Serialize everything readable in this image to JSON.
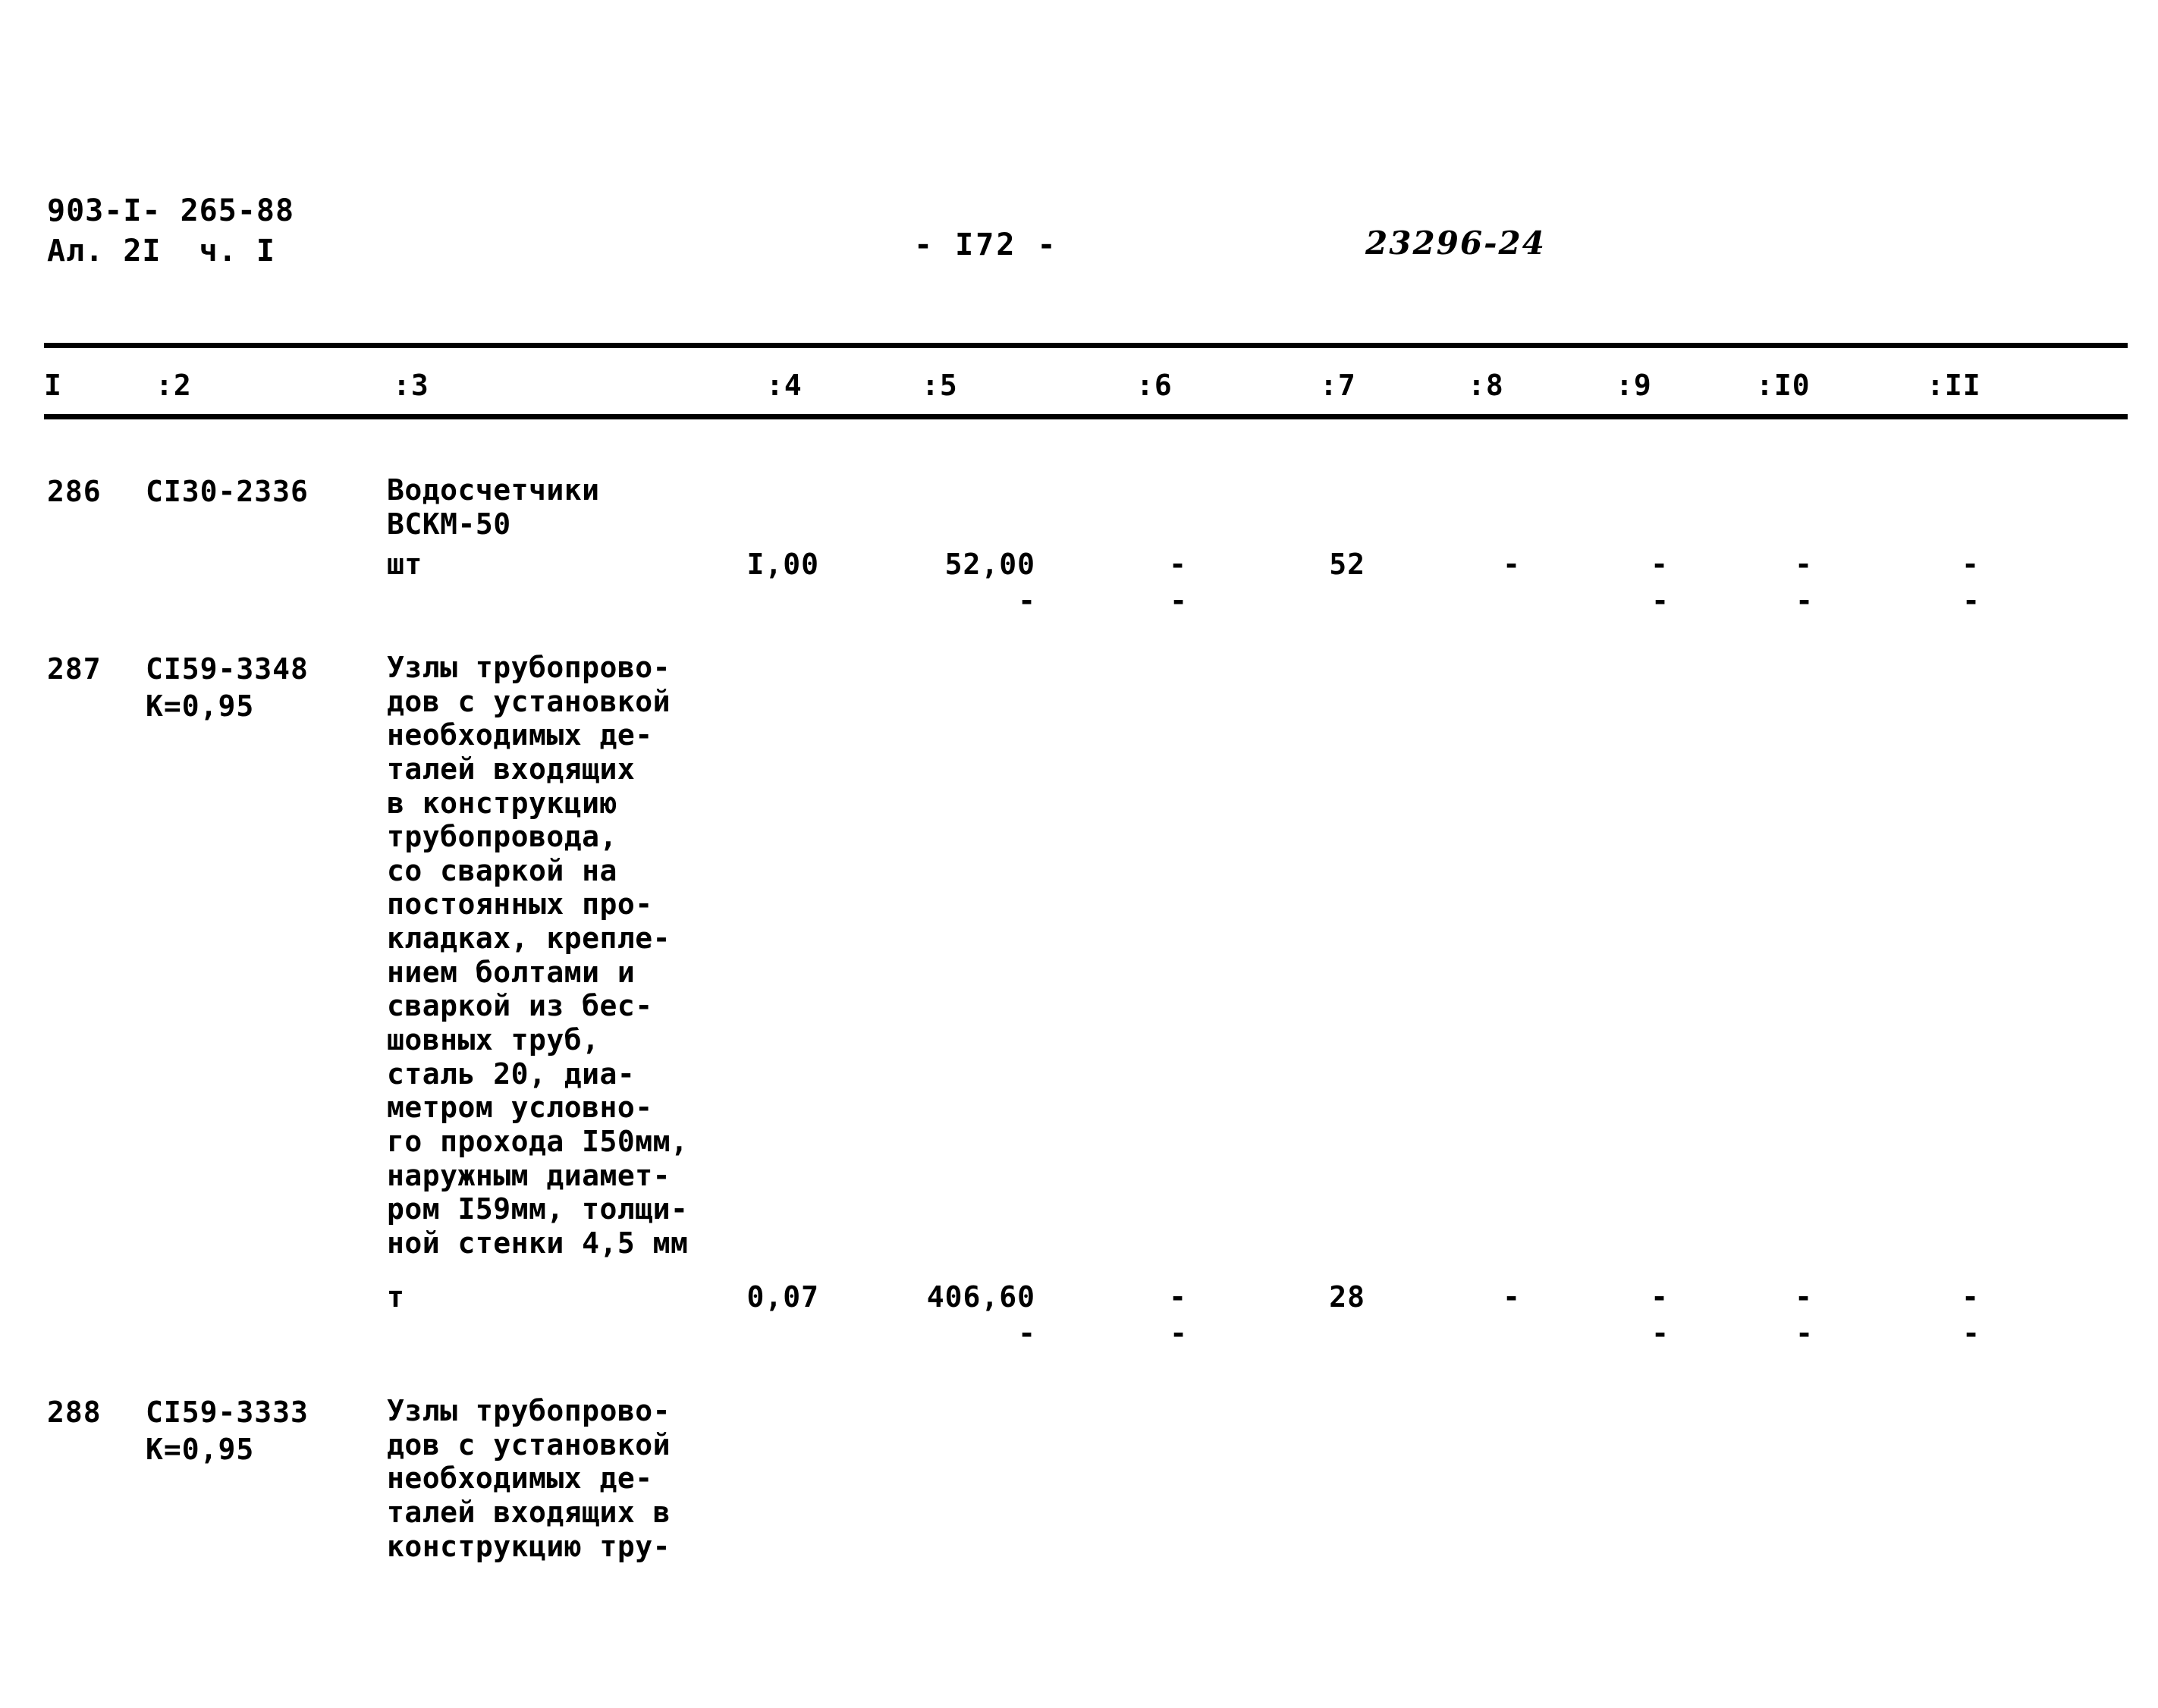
{
  "header": {
    "doc_id_line1": "903-I- 265-88",
    "doc_id_line2": "Ал. 2I  ч. I",
    "page_number": "-  I72  -",
    "doc_code": "23296-24"
  },
  "table": {
    "columns": [
      "I",
      ":2",
      ":3",
      ":4",
      ":5",
      ":6",
      ":7",
      ":8",
      ":9",
      ":I0",
      ":II"
    ],
    "rows": [
      {
        "num": "286",
        "code_lines": [
          "CI30-2336"
        ],
        "desc_lines": [
          "Водосчетчики",
          "ВСКМ-50"
        ],
        "unit": "шт",
        "c4": "I,00",
        "c5": "52,00",
        "c5b": "-",
        "c6": "-",
        "c6b": "-",
        "c7": "52",
        "c8": "-",
        "c9": "-",
        "c9b": "-",
        "c10": "-",
        "c10b": "-",
        "c11": "-",
        "c11b": "-"
      },
      {
        "num": "287",
        "code_lines": [
          "CI59-3348",
          "К=0,95"
        ],
        "desc_lines": [
          "Узлы трубопрово-",
          "дов с установкой",
          "необходимых де-",
          "талей входящих",
          "в конструкцию",
          "трубопровода,",
          "со сваркой на",
          "постоянных про-",
          "кладках, крепле-",
          "нием болтами и",
          "сваркой из бес-",
          "шовных труб,",
          "сталь 20, диа-",
          "метром условно-",
          "го прохода I50мм,",
          "наружным диамет-",
          "ром I59мм, толщи-",
          "ной стенки 4,5 мм"
        ],
        "unit": "т",
        "c4": "0,07",
        "c5": "406,60",
        "c5b": "-",
        "c6": "-",
        "c6b": "-",
        "c7": "28",
        "c8": "-",
        "c9": "-",
        "c9b": "-",
        "c10": "-",
        "c10b": "-",
        "c11": "-",
        "c11b": "-"
      },
      {
        "num": "288",
        "code_lines": [
          "CI59-3333",
          "К=0,95"
        ],
        "desc_lines": [
          "Узлы трубопрово-",
          "дов с установкой",
          "необходимых де-",
          "талей входящих в",
          "конструкцию тру-"
        ]
      }
    ]
  }
}
